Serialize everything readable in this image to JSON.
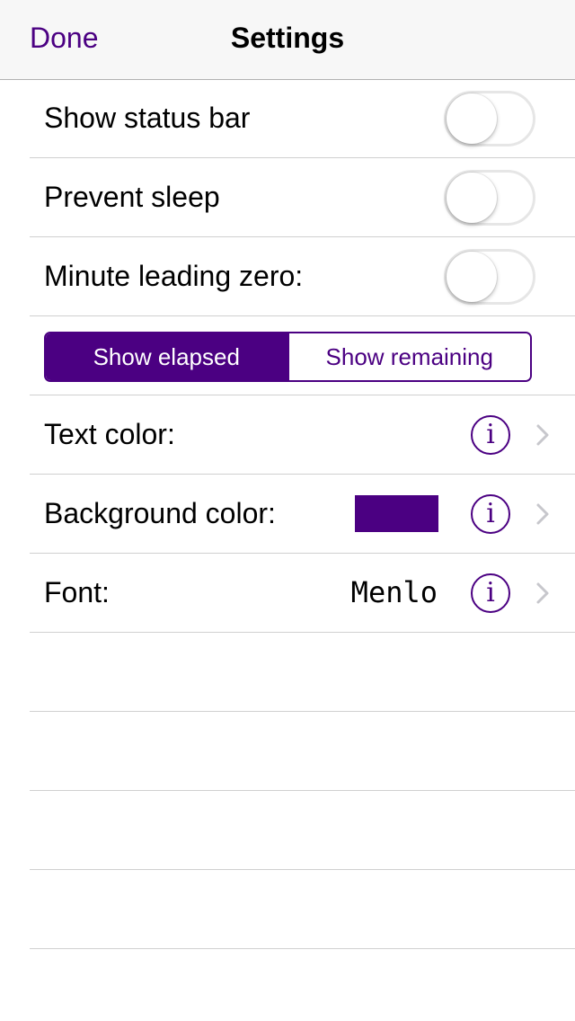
{
  "nav": {
    "done_label": "Done",
    "title": "Settings"
  },
  "toggles": [
    {
      "label": "Show status bar",
      "on": false
    },
    {
      "label": "Prevent sleep",
      "on": false
    },
    {
      "label": "Minute leading zero:",
      "on": false
    }
  ],
  "segmented": {
    "options": [
      "Show elapsed",
      "Show remaining"
    ],
    "selected": "Show elapsed"
  },
  "detail_rows": {
    "text_color": {
      "label": "Text color:"
    },
    "background_color": {
      "label": "Background color:",
      "swatch_color": "#4b0082"
    },
    "font": {
      "label": "Font:",
      "value": "Menlo"
    }
  },
  "colors": {
    "accent": "#4b0082",
    "navbar_bg": "#f7f7f7",
    "separator": "#d0d0d0",
    "chevron": "#c7c7cc"
  },
  "icons": {
    "info": "info-icon",
    "chevron": "chevron-right-icon"
  }
}
